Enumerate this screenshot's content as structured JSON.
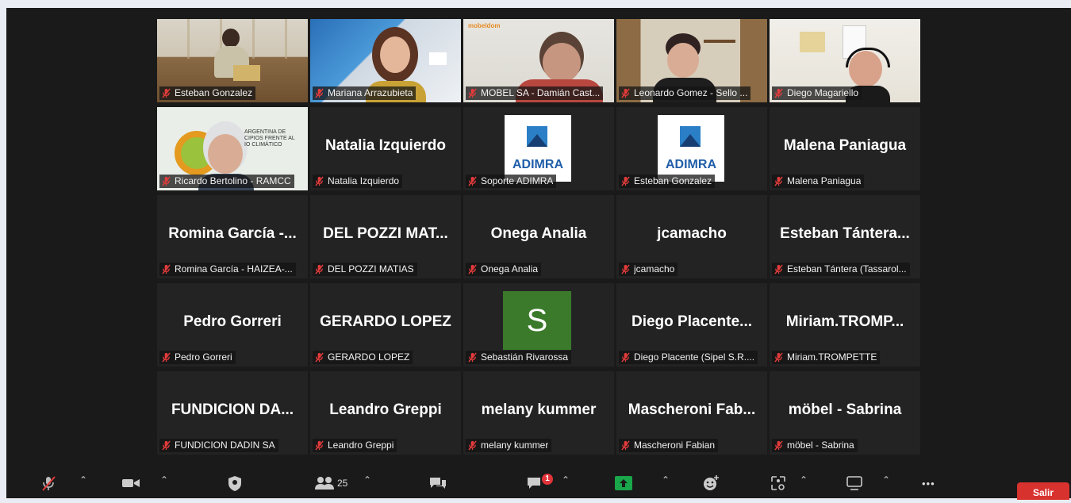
{
  "participants": [
    {
      "name": "Esteban Gonzalez",
      "big": "",
      "kind": "video",
      "scene": "office"
    },
    {
      "name": "Mariana Arrazubieta",
      "big": "",
      "kind": "video",
      "scene": "woman"
    },
    {
      "name": "MOBEL SA - Damián Cast...",
      "big": "",
      "kind": "video",
      "scene": "mobel",
      "watermark": "mobeldom"
    },
    {
      "name": "Leonardo Gomez - Sello ...",
      "big": "",
      "kind": "video",
      "scene": "young"
    },
    {
      "name": "Diego Magariello",
      "big": "",
      "kind": "video",
      "scene": "headset"
    },
    {
      "name": "Ricardo Bertolino - RAMCC",
      "big": "",
      "kind": "video",
      "scene": "ricardo",
      "active": true,
      "banner": [
        "ARGENTINA DE",
        "CIPIOS FRENTE AL",
        "IO CLIMÁTICO"
      ]
    },
    {
      "name": "Natalia Izquierdo",
      "big": "Natalia Izquierdo",
      "kind": "name"
    },
    {
      "name": "Soporte ADIMRA",
      "big": "",
      "kind": "logo",
      "logo_text": "ADIMRA"
    },
    {
      "name": "Esteban Gonzalez",
      "big": "",
      "kind": "logo",
      "logo_text": "ADIMRA"
    },
    {
      "name": "Malena Paniagua",
      "big": "Malena Paniagua",
      "kind": "name"
    },
    {
      "name": "Romina García - HAIZEA-...",
      "big": "Romina García -...",
      "kind": "name"
    },
    {
      "name": "DEL POZZI MATIAS",
      "big": "DEL POZZI MAT...",
      "kind": "name"
    },
    {
      "name": "Onega Analia",
      "big": "Onega Analia",
      "kind": "name"
    },
    {
      "name": "jcamacho",
      "big": "jcamacho",
      "kind": "name"
    },
    {
      "name": "Esteban Tántera (Tassarol...",
      "big": "Esteban Tántera...",
      "kind": "name"
    },
    {
      "name": "Pedro Gorreri",
      "big": "Pedro Gorreri",
      "kind": "name"
    },
    {
      "name": "GERARDO LOPEZ",
      "big": "GERARDO LOPEZ",
      "kind": "name"
    },
    {
      "name": "Sebastián Rivarossa",
      "big": "",
      "kind": "avatar",
      "avatar_letter": "S"
    },
    {
      "name": "Diego Placente (Sipel S.R....",
      "big": "Diego Placente...",
      "kind": "name"
    },
    {
      "name": "Miriam.TROMPETTE",
      "big": "Miriam.TROMP...",
      "kind": "name"
    },
    {
      "name": "FUNDICION DADIN SA",
      "big": "FUNDICION DA...",
      "kind": "name"
    },
    {
      "name": "Leandro Greppi",
      "big": "Leandro Greppi",
      "kind": "name"
    },
    {
      "name": "melany kummer",
      "big": "melany kummer",
      "kind": "name"
    },
    {
      "name": "Mascheroni Fabian",
      "big": "Mascheroni Fab...",
      "kind": "name"
    },
    {
      "name": "möbel - Sabrina",
      "big": "möbel - Sabrina",
      "kind": "name"
    }
  ],
  "toolbar": {
    "participants_count": "25",
    "chat_badge": "1",
    "leave_label": "Salir",
    "more_label": "•••"
  },
  "colors": {
    "active_speaker": "#e5e56a",
    "leave": "#d8322e",
    "share": "#1aa64a",
    "badge": "#e2333a",
    "avatar": "#3a7a2a"
  }
}
